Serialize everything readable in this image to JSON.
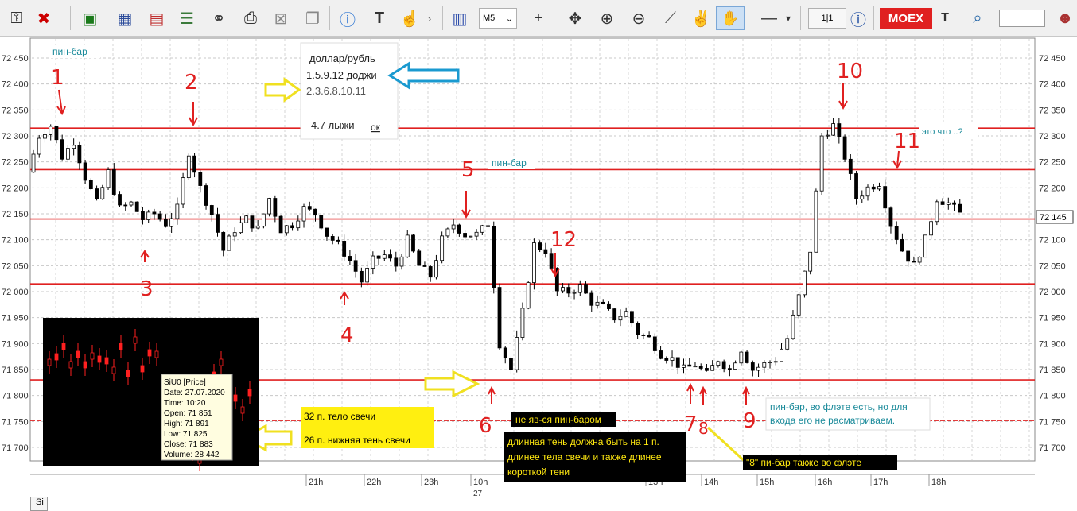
{
  "toolbar": {
    "timeframe": "M5",
    "grid_label": "1|1",
    "exchange_label": "MOEX",
    "extra_label": "T",
    "buttons": [
      "key-icon",
      "delete-icon",
      "new-chart-icon",
      "bar-chart-icon",
      "line-chart-icon",
      "indicators-icon",
      "handshake-icon",
      "search-doc-icon",
      "close-doc-icon",
      "copy-icon",
      "alert-icon",
      "text-icon",
      "gesture-icon",
      "chart-type-icon",
      "crosshair-icon",
      "move-icon",
      "zoom-in-icon",
      "zoom-out-icon",
      "ruler-icon",
      "peace-icon",
      "hand-icon",
      "line-icon",
      "info-icon",
      "portfolio-icon",
      "person-icon"
    ]
  },
  "chart_data": {
    "type": "candlestick",
    "ylim": [
      71650,
      72500
    ],
    "y_ticks": [
      "72 450",
      "72 400",
      "72 350",
      "72 300",
      "72 250",
      "72 200",
      "72 150",
      "72 100",
      "72 050",
      "72 000",
      "71 950",
      "71 900",
      "71 850",
      "71 800",
      "71 750",
      "71 700"
    ],
    "x_ticks": [
      "21h",
      "22h",
      "23h",
      "10h",
      "13h",
      "14h",
      "15h",
      "16h",
      "17h",
      "18h"
    ],
    "x_sub_label": "27",
    "x_left_label": "Si",
    "last_price": "72 145",
    "horizontal_levels": [
      72315,
      72235,
      72140,
      72015,
      71830,
      71752
    ],
    "path": [
      72230,
      72300,
      72320,
      72260,
      72290,
      72220,
      72170,
      72230,
      72160,
      72170,
      72140,
      72150,
      72130,
      72160,
      72270,
      72200,
      72150,
      72080,
      72120,
      72140,
      72120,
      72180,
      72120,
      72130,
      72160,
      72150,
      72110,
      72090,
      72060,
      72020,
      72060,
      72070,
      72050,
      72100,
      72050,
      72030,
      72100,
      72130,
      72110,
      72110,
      72130,
      71900,
      71850,
      71960,
      72090,
      72080,
      72000,
      72000,
      72010,
      71980,
      71970,
      71950,
      71960,
      71920,
      71910,
      71880,
      71870,
      71850,
      71860,
      71840,
      71870,
      71850,
      71890,
      71850,
      71860,
      71870,
      71910,
      71990,
      72080,
      72300,
      72320,
      72260,
      72180,
      72200,
      72210,
      72130,
      72080,
      72050,
      72100,
      72180,
      72170,
      72150
    ]
  },
  "annotations": {
    "pin_bar_1": "пин-бар",
    "pin_bar_2": "пин-бар",
    "what_is": "это что ..?",
    "legend_title": "доллар/рубль",
    "legend_line1": "1.5.9.12 доджи",
    "legend_line2": "2.3.6.8.10.11",
    "legend_line3": "4.7 лыжи",
    "legend_ok": "ок",
    "body_text": "32 п. тело свечи",
    "shadow_text": "26 п. нижняя тень свечи",
    "not_pin": "не яв-ся пин-баром",
    "long_shadow_1": "длинная тень должна быть на 1 п.",
    "long_shadow_2": "длинее тела свечи и также длинее",
    "long_shadow_3": "короткой тени",
    "flat_note_1": "пин-бар, во флэте есть, но для",
    "flat_note_2": "входа его не расматриваем.",
    "flat_8": "\"8\" пи-бар также во флэте",
    "numbers": [
      "1",
      "2",
      "3",
      "4",
      "5",
      "6",
      "7",
      "8",
      "9",
      "10",
      "11",
      "12"
    ]
  },
  "tooltip": {
    "symbol": "SiU0 [Price]",
    "date": "Date: 27.07.2020",
    "time": "Time: 10:20",
    "open": "Open:  71 851",
    "high": "High:   71 891",
    "low": "Low:    71 825",
    "close": "Close: 71 883",
    "volume": "Volume: 28 442"
  }
}
